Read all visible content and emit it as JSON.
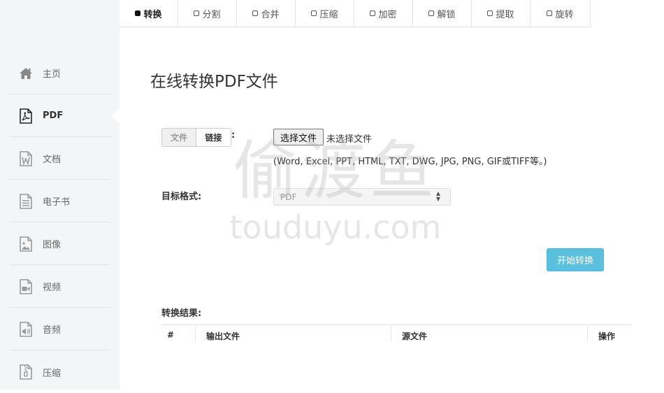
{
  "sidebar": {
    "items": [
      {
        "label": "主页",
        "icon": "home-icon"
      },
      {
        "label": "PDF",
        "icon": "pdf-file-icon"
      },
      {
        "label": "文档",
        "icon": "word-document-icon"
      },
      {
        "label": "电子书",
        "icon": "ebook-icon"
      },
      {
        "label": "图像",
        "icon": "image-file-icon"
      },
      {
        "label": "视频",
        "icon": "video-file-icon"
      },
      {
        "label": "音频",
        "icon": "audio-file-icon"
      },
      {
        "label": "压缩",
        "icon": "zip-file-icon"
      }
    ],
    "active_index": 1
  },
  "topnav": {
    "tabs": [
      {
        "label": "转换"
      },
      {
        "label": "分割"
      },
      {
        "label": "合并"
      },
      {
        "label": "压缩"
      },
      {
        "label": "加密"
      },
      {
        "label": "解锁"
      },
      {
        "label": "提取"
      },
      {
        "label": "旋转"
      }
    ],
    "active_index": 0
  },
  "main": {
    "title": "在线转换PDF文件",
    "source_toggle": {
      "file_label": "文件",
      "link_label": "链接"
    },
    "colon": ":",
    "file_input": {
      "button_label": "选择文件",
      "status": "未选择文件"
    },
    "supported_hint": "(Word, Excel, PPT, HTML, TXT, DWG, JPG, PNG, GIF或TIFF等。)",
    "target_format_label": "目标格式:",
    "target_format_value": "PDF",
    "start_button": "开始转换",
    "result_label": "转换结果:",
    "table_headers": {
      "index": "#",
      "output": "输出文件",
      "source": "源文件",
      "action": "操作"
    }
  },
  "watermark": {
    "cn": "偷渡鱼",
    "en": "touduyu.com"
  },
  "colors": {
    "accent": "#5bc0de",
    "sidebar_bg": "#f4f5f6",
    "border": "#e3e4e6"
  }
}
